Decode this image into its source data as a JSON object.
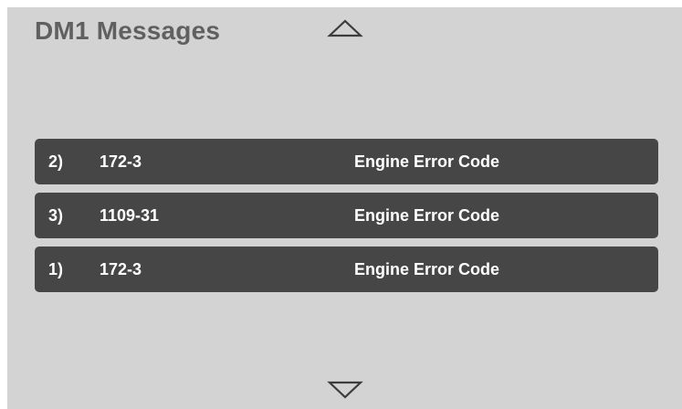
{
  "header": {
    "title": "DM1 Messages"
  },
  "controls": {
    "scroll_up_icon": "triangle-up-outline",
    "scroll_down_icon": "triangle-down-outline"
  },
  "messages": [
    {
      "index": "2)",
      "code": "172-3",
      "description": "Engine Error Code"
    },
    {
      "index": "3)",
      "code": "1109-31",
      "description": "Engine Error Code"
    },
    {
      "index": "1)",
      "code": "172-3",
      "description": "Engine Error Code"
    }
  ],
  "colors": {
    "panel_background": "#d3d3d3",
    "row_background": "#464646",
    "title_text": "#606060",
    "row_text": "#ffffff",
    "icon_stroke": "#3c3c3c"
  }
}
